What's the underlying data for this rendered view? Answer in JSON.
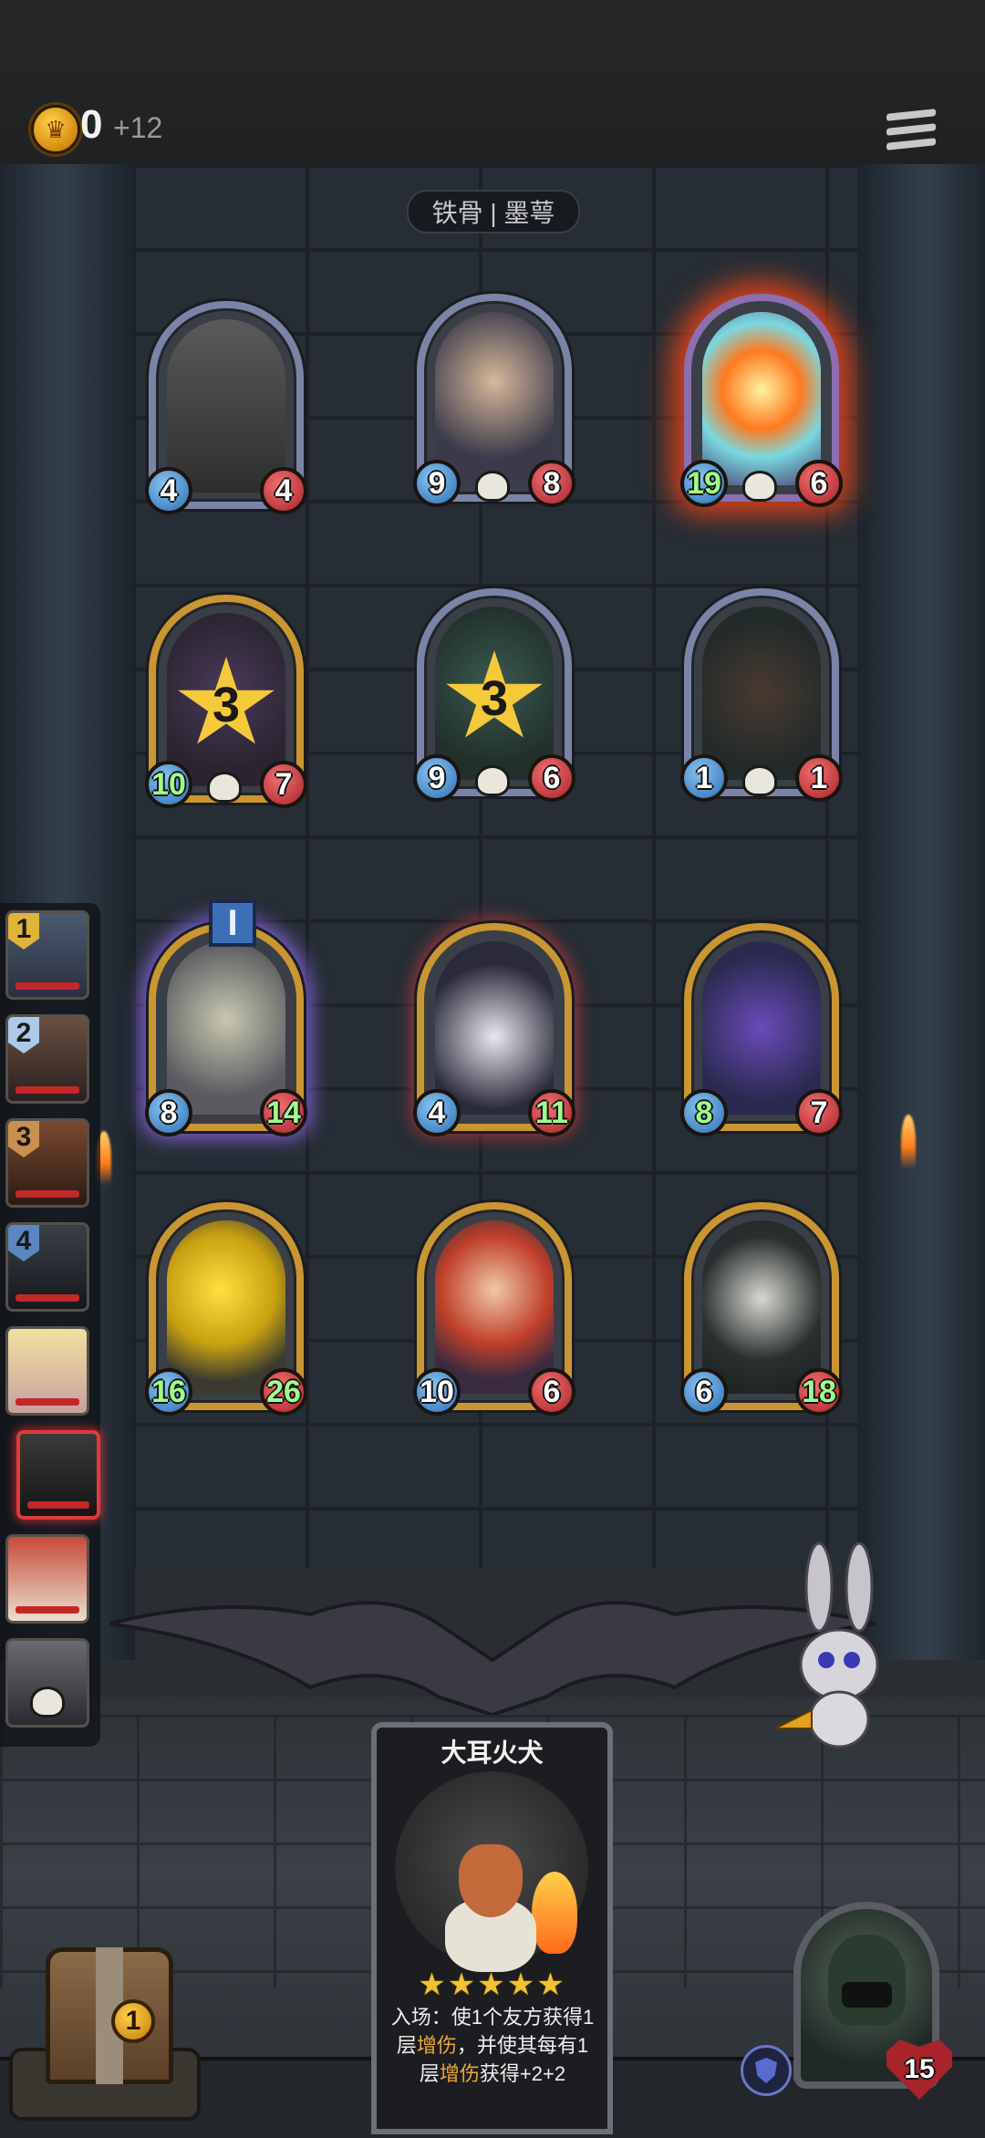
{
  "header": {
    "gold": "0",
    "income": "+12"
  },
  "opponent": {
    "name": "铁骨 | 墨萼"
  },
  "opponent_board": [
    {
      "attack": "4",
      "health": "4",
      "art": "ballerina-music-box"
    },
    {
      "attack": "9",
      "health": "8",
      "art": "girl-with-bangs"
    },
    {
      "attack": "19",
      "health": "6",
      "art": "burning-crystal"
    }
  ],
  "opponent_board_row2": [
    {
      "attack": "10",
      "health": "7",
      "star": "3",
      "art": "witch-hat"
    },
    {
      "attack": "9",
      "health": "6",
      "star": "3",
      "art": "tentacle"
    },
    {
      "attack": "1",
      "health": "1",
      "art": "chest-mimic"
    }
  ],
  "player_board": [
    {
      "attack": "8",
      "health": "14",
      "tier": "I",
      "art": "hooded-bear"
    },
    {
      "attack": "4",
      "health": "11",
      "art": "penguin"
    },
    {
      "attack": "8",
      "health": "7",
      "art": "purple-dragon"
    }
  ],
  "player_board_row2": [
    {
      "attack": "16",
      "health": "26",
      "art": "yellow-slime"
    },
    {
      "attack": "10",
      "health": "6",
      "art": "red-haired-elf"
    },
    {
      "attack": "6",
      "health": "18",
      "art": "reaper"
    }
  ],
  "players": [
    {
      "rank": "1"
    },
    {
      "rank": "2"
    },
    {
      "rank": "3"
    },
    {
      "rank": "4"
    },
    {
      "rank": ""
    },
    {
      "rank": "",
      "current": true
    },
    {
      "rank": ""
    },
    {
      "rank": ""
    }
  ],
  "shop_card": {
    "name": "大耳火犬",
    "stars": "★★★★★",
    "text_prefix": "入场：使1个友方获得1层",
    "keyword": "增伤",
    "text_mid": "，并使其每有1层",
    "text_suffix": "获得+2+2"
  },
  "refresh": {
    "cost": "1"
  },
  "hero": {
    "health": "15"
  }
}
